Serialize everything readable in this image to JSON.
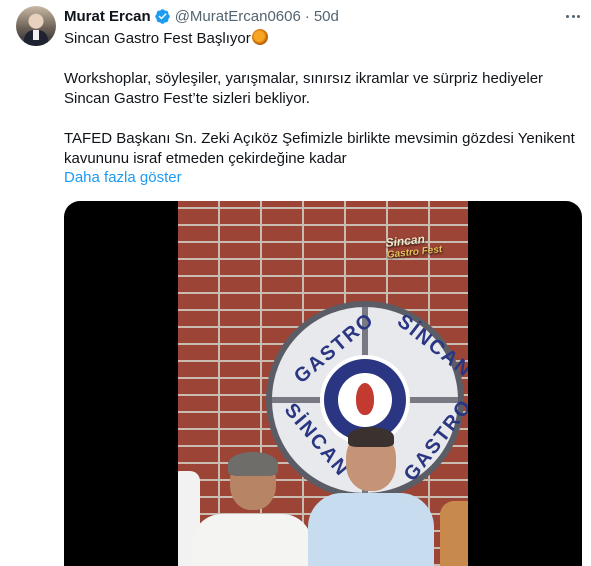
{
  "author": {
    "name": "Murat Ercan",
    "handle": "@MuratErcan0606",
    "separator": "·",
    "time": "50d"
  },
  "icons": {
    "verified": "verified-badge-icon",
    "more": "more-horizontal-icon",
    "emoji": "cooking-pan-emoji"
  },
  "colors": {
    "verified": "#1d9bf0",
    "link": "#1d9bf0",
    "muted": "#536471",
    "text": "#0f1419"
  },
  "tweet": {
    "line1": "Sincan Gastro Fest Başlıyor",
    "line2": "Workshoplar, söyleşiler, yarışmalar, sınırsız ikramlar ve sürpriz hediyeler",
    "line3": "Sincan Gastro Fest’te sizleri bekliyor.",
    "line4": "TAFED Başkanı Sn. Zeki Açıköz Şefimizle birlikte mevsimin gözdesi Yenikent",
    "line5": "kavununu israf etmeden çekirdeğine kadar",
    "show_more": "Daha fazla göster"
  },
  "media": {
    "brand_top": "Sincan",
    "brand_bottom": "Gastro Fest",
    "sign_words": [
      "GASTRO",
      "SİNCAN",
      "SİNCAN",
      "GASTRO"
    ]
  }
}
